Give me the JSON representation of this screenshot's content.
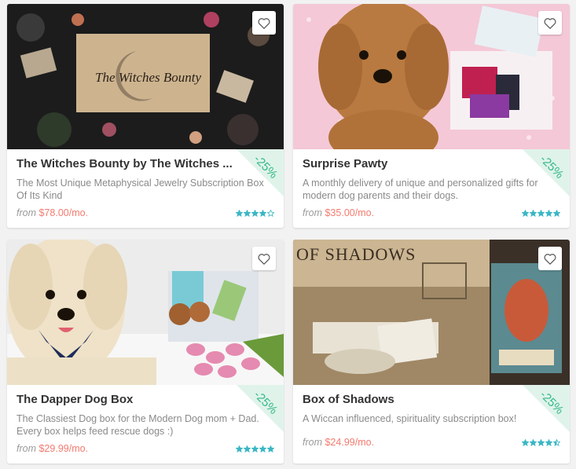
{
  "colors": {
    "accent_price": "#f47a6e",
    "discount_green": "#34b889",
    "star_teal": "#3bb7c4"
  },
  "cards": [
    {
      "title": "The Witches Bounty by The Witches ...",
      "description": "The Most Unique Metaphysical Jewelry Subscription Box Of Its Kind",
      "price_prefix": "from",
      "price": "$78.00",
      "price_suffix": "/mo.",
      "discount": "-25%",
      "rating": 4,
      "image_text": "The Witches Bounty",
      "favorite_icon": "heart-outline-icon"
    },
    {
      "title": "Surprise Pawty",
      "description": "A monthly delivery of unique and personalized gifts for modern dog parents and their dogs.",
      "price_prefix": "from",
      "price": "$35.00",
      "price_suffix": "/mo.",
      "discount": "-25%",
      "rating": 5,
      "favorite_icon": "heart-outline-icon"
    },
    {
      "title": "The Dapper Dog Box",
      "description": "The Classiest Dog box for the Modern Dog mom + Dad. Every box helps feed rescue dogs :)",
      "price_prefix": "from",
      "price": "$29.99",
      "price_suffix": "/mo.",
      "discount": "-25%",
      "rating": 5,
      "favorite_icon": "heart-outline-icon"
    },
    {
      "title": "Box of Shadows",
      "description": "A Wiccan influenced, spirituality subscription box!",
      "price_prefix": "from",
      "price": "$24.99",
      "price_suffix": "/mo.",
      "discount": "-25%",
      "rating": 4.5,
      "image_text": "OF SHADOWS",
      "favorite_icon": "heart-outline-icon"
    }
  ]
}
